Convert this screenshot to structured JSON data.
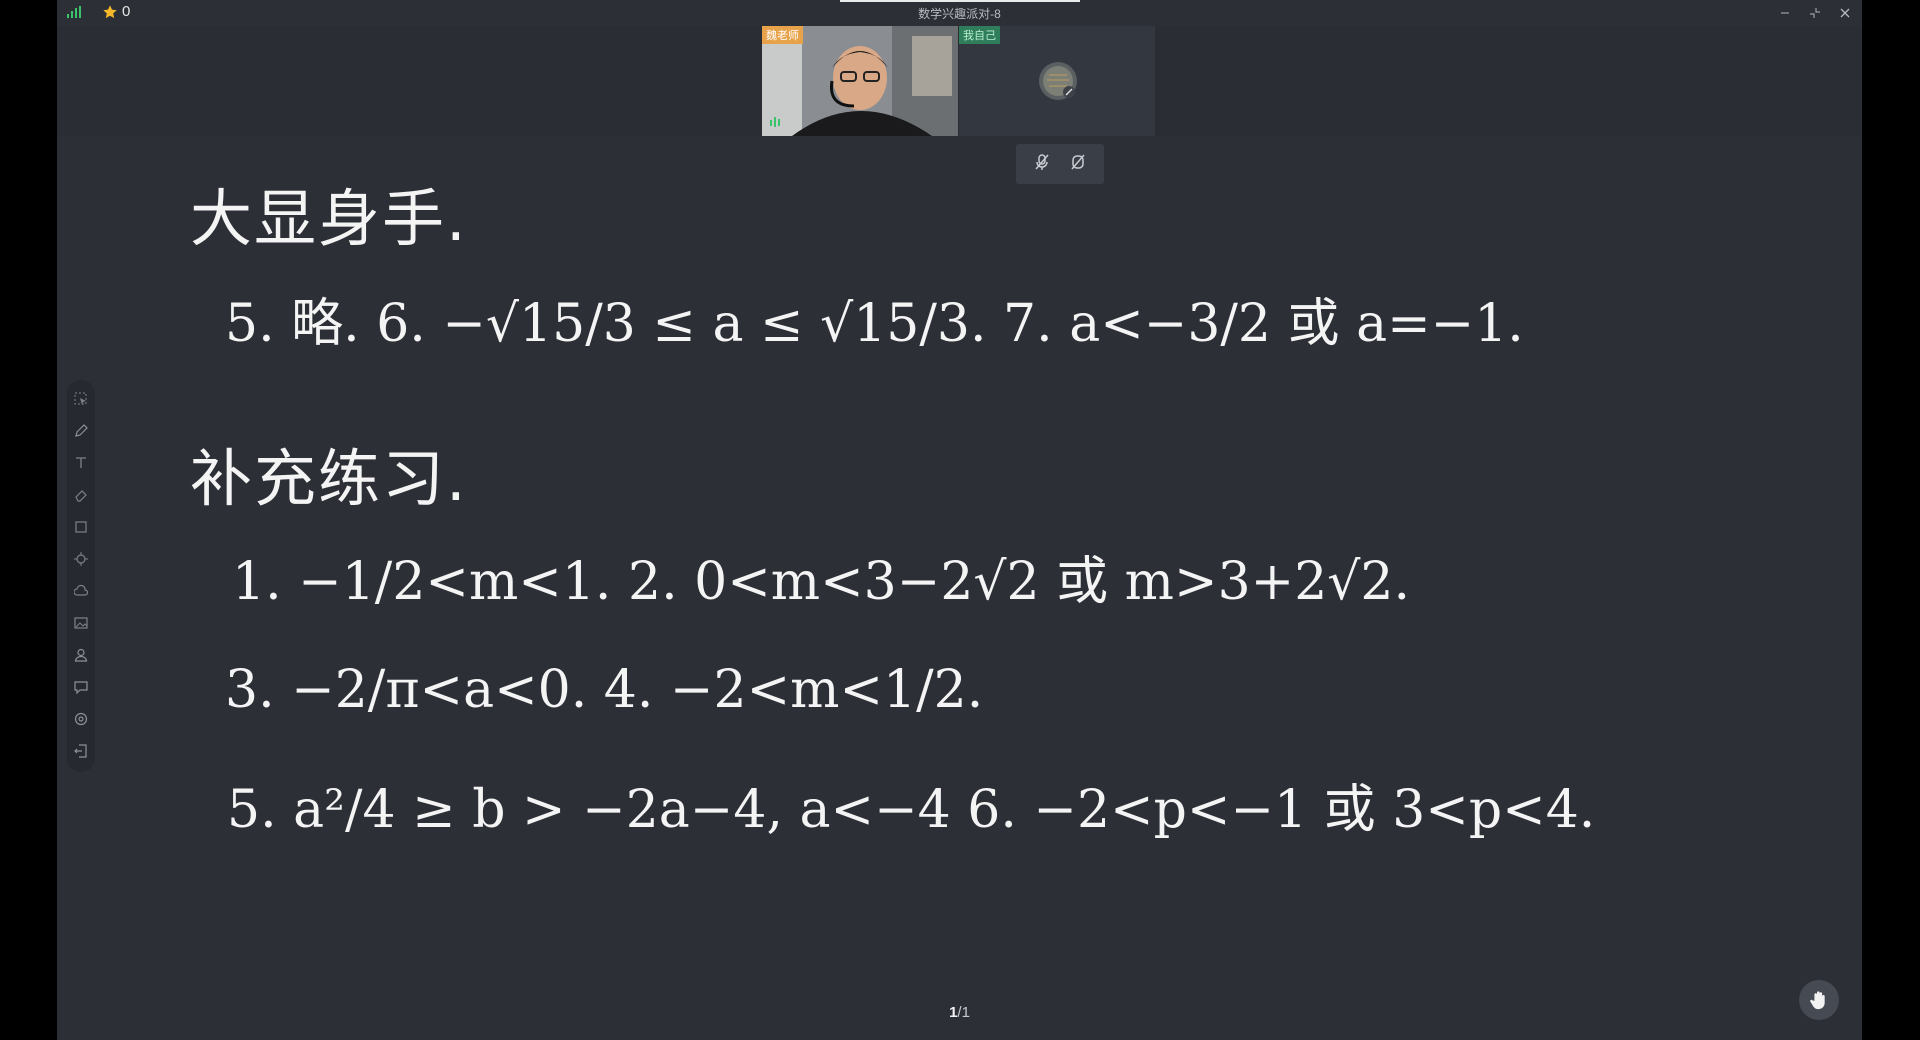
{
  "titlebar": {
    "title": "数学兴趣派对-8",
    "star_count": "0"
  },
  "video": {
    "teacher_label": "魏老师",
    "self_label": "我自己"
  },
  "board": {
    "heading1": "大显身手.",
    "answers_line": "5. 略.   6. −√15/3 ≤ a ≤ √15/3.   7. a<−3/2 或 a=−1.",
    "heading2": "补充练习.",
    "line1": "1. −1/2<m<1.    2. 0<m<3−2√2 或 m>3+2√2.",
    "line2": "3. −2/π<a<0.   4. −2<m<1/2.",
    "line3": "5. a²/4 ≥ b > −2a−4, a<−4      6. −2<p<−1 或 3<p<4."
  },
  "pager": {
    "current": "1",
    "total": "/1"
  },
  "icons": {
    "accent": "#e8a24a",
    "self_badge": "#2f7d5b"
  }
}
